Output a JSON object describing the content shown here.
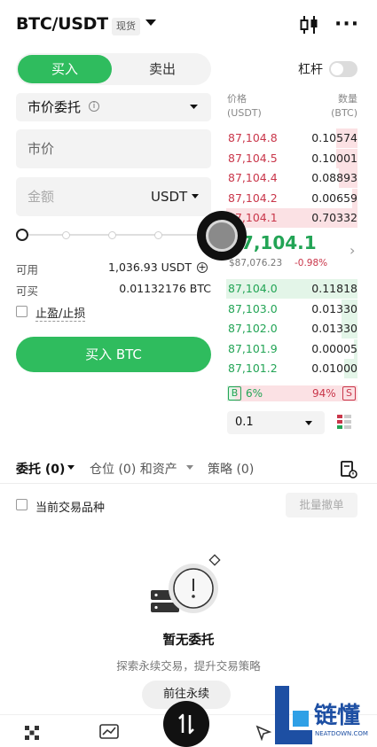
{
  "header": {
    "pair": "BTC/USDT",
    "tag": "现货"
  },
  "tabs": {
    "buy": "买入",
    "sell": "卖出"
  },
  "leverage": {
    "label": "杠杆",
    "enabled": false
  },
  "order_type": {
    "label": "市价委托",
    "info_icon": "i"
  },
  "price_field": {
    "placeholder": "市价"
  },
  "amount_field": {
    "placeholder": "金额",
    "unit": "USDT"
  },
  "available": {
    "label": "可用",
    "value": "1,036.93 USDT"
  },
  "can_buy": {
    "label": "可买",
    "value": "0.01132176 BTC"
  },
  "tpsl": {
    "label": "止盈/止损"
  },
  "submit": {
    "label": "买入 BTC"
  },
  "orderbook": {
    "price_header": "价格",
    "price_unit": "(USDT)",
    "qty_header": "数量",
    "qty_unit": "(BTC)",
    "asks": [
      {
        "price": "87,104.8",
        "qty": "0.10574",
        "depth": 0.16
      },
      {
        "price": "87,104.5",
        "qty": "0.10001",
        "depth": 0.16
      },
      {
        "price": "87,104.4",
        "qty": "0.08893",
        "depth": 0.14
      },
      {
        "price": "87,104.2",
        "qty": "0.00659",
        "depth": 0.04
      },
      {
        "price": "87,104.1",
        "qty": "0.70332",
        "depth": 1.0
      }
    ],
    "mid_price": "87,104.1",
    "mid_ref": "$87,076.23",
    "mid_change": "-0.98%",
    "bids": [
      {
        "price": "87,104.0",
        "qty": "0.11818",
        "depth": 1.0
      },
      {
        "price": "87,103.0",
        "qty": "0.01330",
        "depth": 0.12
      },
      {
        "price": "87,102.0",
        "qty": "0.01330",
        "depth": 0.12
      },
      {
        "price": "87,101.9",
        "qty": "0.00005",
        "depth": 0.03
      },
      {
        "price": "87,101.2",
        "qty": "0.01000",
        "depth": 0.1
      }
    ],
    "ratio_b_label": "B",
    "ratio_b": "6%",
    "ratio_s": "94%",
    "ratio_s_label": "S",
    "ratio_b_value": 0.06,
    "precision": "0.1"
  },
  "bottom_tabs": {
    "orders": "委托 (0)",
    "positions": "仓位 (0) 和资产",
    "strategy": "策略 (0)"
  },
  "filter": {
    "current_only": "当前交易品种",
    "batch_cancel": "批量撤单"
  },
  "empty": {
    "title": "暂无委托",
    "subtitle": "探索永续交易，提升交易策略",
    "button": "前往永续"
  },
  "colors": {
    "buy_green": "#2fbc5e",
    "ask_red": "#c9364a",
    "bid_green": "#22a455"
  },
  "watermark": {
    "text": "链懂",
    "sub": "NEATDOWN.COM"
  }
}
